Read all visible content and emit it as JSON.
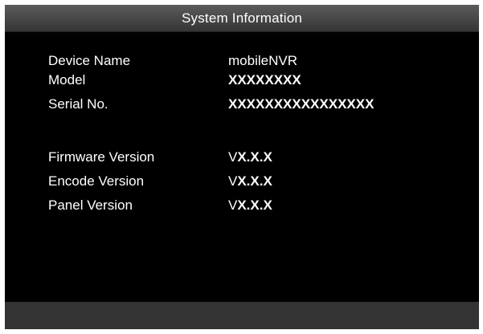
{
  "window": {
    "title": "System Information"
  },
  "device_info": [
    {
      "label": "Device Name",
      "value": "mobileNVR"
    },
    {
      "label": "Model",
      "value": "XXXXXXXX"
    },
    {
      "label": "Serial No.",
      "value": "XXXXXXXXXXXXXXXX"
    }
  ],
  "versions": [
    {
      "label": "Firmware Version",
      "prefix": "V",
      "value": "X.X.X"
    },
    {
      "label": "Encode Version",
      "prefix": "V",
      "value": "X.X.X"
    },
    {
      "label": "Panel Version",
      "prefix": "V",
      "value": "X.X.X"
    }
  ],
  "colors": {
    "background": "#000000",
    "title_bar": "#4a4a4a",
    "footer_bar": "#333333",
    "text": "#ffffff"
  }
}
